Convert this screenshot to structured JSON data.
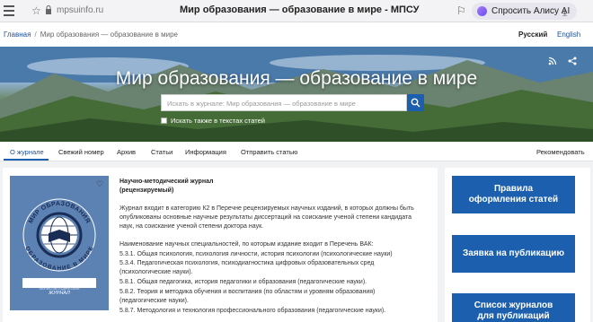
{
  "browser": {
    "url": "mpsuinfo.ru",
    "tab_title": "Мир образования — образование в мире - МПСУ",
    "alice_label": "Спросить Алису AI"
  },
  "breadcrumb": {
    "home": "Главная",
    "separator": "/",
    "current": "Мир образования — образование в мире"
  },
  "lang": {
    "ru": "Русский",
    "en": "English"
  },
  "hero": {
    "title": "Мир образования — образование в мире",
    "search_placeholder": "Искать в журнале: Мир образования — образование в мире",
    "checkbox_label": "Искать также в текстах статей"
  },
  "nav": {
    "items": [
      "О журнале",
      "Свежий номер",
      "Архив",
      "Статьи",
      "Информация",
      "Отправить статью"
    ],
    "recommend": "Рекомендовать"
  },
  "cover": {
    "arc_top": "МИР ОБРАЗОВАНИЯ",
    "arc_bottom": "ОБРАЗОВАНИЕ В МИРЕ",
    "caption_small": "НАУЧНО-МЕТОДИЧЕСКИЙ",
    "caption": "ЖУРНАЛ"
  },
  "about": {
    "type_line1": "Научно-методический журнал",
    "type_line2": "(рецензируемый)",
    "desc_line1": "Журнал входит в категорию К2 в Перечне рецензируемых научных изданий, в которых должны быть",
    "desc_line2": "опубликованы основные научные результаты диссертаций на соискание ученой степени кандидата",
    "desc_line3": "наук, на соискание ученой степени доктора наук.",
    "spec_header": "Наименование научных специальностей, по которым издание входит в Перечень ВАК:",
    "specs": [
      "5.3.1. Общая психология, психология личности, история психологии (психологические науки)",
      "5.3.4. Педагогическая психология, психодиагностика цифровых образовательных сред",
      "(психологические науки).",
      "5.8.1. Общая педагогика, история педагогики и образования (педагогические науки).",
      "5.8.2. Теория и методика обучения и воспитания (по областям и уровням образования)",
      "(педагогические науки).",
      "5.8.7. Методология и технология профессионального образования (педагогические науки)."
    ]
  },
  "sidebar": {
    "btn1_line1": "Правила",
    "btn1_line2": "оформления статей",
    "btn2": "Заявка на публикацию",
    "btn3_line1": "Список журналов",
    "btn3_line2": "для публикаций"
  },
  "colors": {
    "accent": "#1b5fae",
    "link": "#1b4f9c",
    "cover": "#5c82b4"
  }
}
